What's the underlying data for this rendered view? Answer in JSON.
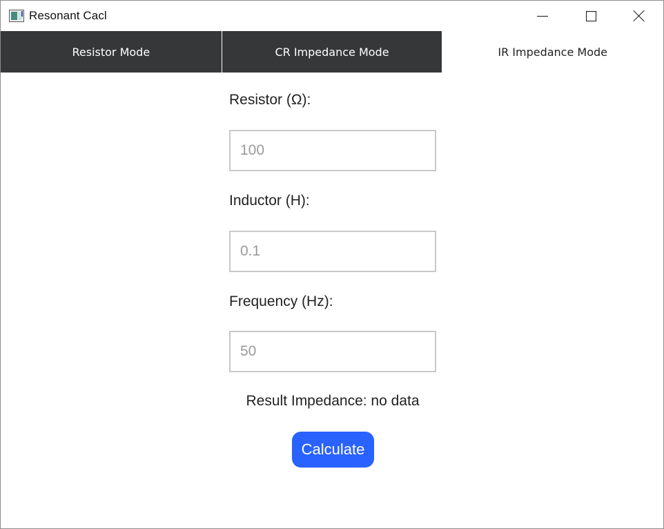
{
  "window": {
    "title": "Resonant Cacl"
  },
  "tabs": [
    {
      "label": "Resistor Mode"
    },
    {
      "label": "CR Impedance Mode"
    },
    {
      "label": "IR Impedance Mode"
    }
  ],
  "form": {
    "resistor_label": "Resistor (Ω):",
    "resistor_placeholder": "100",
    "inductor_label": "Inductor (H):",
    "inductor_placeholder": "0.1",
    "frequency_label": "Frequency (Hz):",
    "frequency_placeholder": "50",
    "result_text": "Result Impedance: no data",
    "calculate_label": "Calculate"
  },
  "colors": {
    "tab_dark": "#363738",
    "accent": "#2962ff"
  },
  "icons": {
    "app": "app-icon",
    "minimize": "minimize-icon",
    "maximize": "maximize-icon",
    "close": "close-icon"
  }
}
